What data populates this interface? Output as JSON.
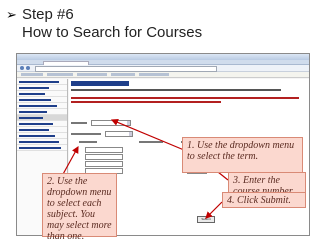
{
  "slide": {
    "bullet_icon": "arrow-bullet-icon",
    "title_line1": "Step #6",
    "title_line2": "How to Search for Courses"
  },
  "screenshot": {
    "submit_label": "Submit"
  },
  "callouts": {
    "step1": "1. Use the dropdown menu to select the term.",
    "step2": "2. Use the dropdown menu to select each subject. You may select more than one.",
    "step3": "3. Enter the course number here.",
    "step4": "4. Click Submit."
  },
  "colors": {
    "callout_fill": "#fbd8cf",
    "callout_border": "#d98a76",
    "arrow_red": "#c00000",
    "nav_blue": "#1f3f8a"
  }
}
